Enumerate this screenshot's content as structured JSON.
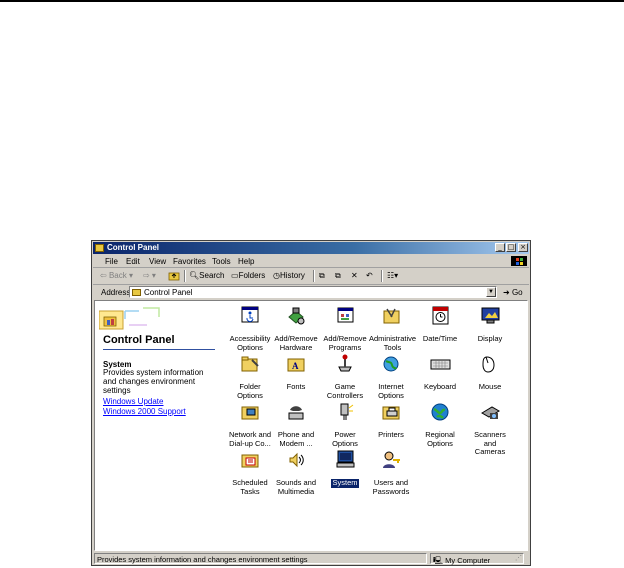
{
  "window": {
    "title": "Control Panel",
    "buttons": {
      "minimize": "_",
      "maximize": "□",
      "close": "×"
    }
  },
  "menu": [
    "File",
    "Edit",
    "View",
    "Favorites",
    "Tools",
    "Help"
  ],
  "toolbar": {
    "back": "Back",
    "search": "Search",
    "folders": "Folders",
    "history": "History"
  },
  "address": {
    "label": "Address",
    "value": "Control Panel",
    "go": "Go"
  },
  "left_pane": {
    "title": "Control Panel",
    "selected_name": "System",
    "selected_description": "Provides system information and changes environment settings",
    "links": [
      "Windows Update",
      "Windows 2000 Support"
    ]
  },
  "icons": [
    {
      "label": "Accessibility Options",
      "icon": "accessibility-icon"
    },
    {
      "label": "Add/Remove Hardware",
      "icon": "add-remove-hardware-icon"
    },
    {
      "label": "Add/Remove Programs",
      "icon": "add-remove-programs-icon"
    },
    {
      "label": "Administrative Tools",
      "icon": "administrative-tools-icon"
    },
    {
      "label": "Date/Time",
      "icon": "date-time-icon"
    },
    {
      "label": "Display",
      "icon": "display-icon"
    },
    {
      "label": "Folder Options",
      "icon": "folder-options-icon"
    },
    {
      "label": "Fonts",
      "icon": "fonts-icon"
    },
    {
      "label": "Game Controllers",
      "icon": "game-controllers-icon"
    },
    {
      "label": "Internet Options",
      "icon": "internet-options-icon"
    },
    {
      "label": "Keyboard",
      "icon": "keyboard-icon"
    },
    {
      "label": "Mouse",
      "icon": "mouse-icon"
    },
    {
      "label": "Network and Dial-up Co...",
      "icon": "network-icon"
    },
    {
      "label": "Phone and Modem ...",
      "icon": "phone-modem-icon"
    },
    {
      "label": "Power Options",
      "icon": "power-options-icon"
    },
    {
      "label": "Printers",
      "icon": "printers-icon"
    },
    {
      "label": "Regional Options",
      "icon": "regional-options-icon"
    },
    {
      "label": "Scanners and Cameras",
      "icon": "scanners-cameras-icon"
    },
    {
      "label": "Scheduled Tasks",
      "icon": "scheduled-tasks-icon"
    },
    {
      "label": "Sounds and Multimedia",
      "icon": "sounds-multimedia-icon"
    },
    {
      "label": "System",
      "icon": "system-icon",
      "selected": true
    },
    {
      "label": "Users and Passwords",
      "icon": "users-passwords-icon"
    }
  ],
  "status": {
    "text": "Provides system information and changes environment settings",
    "zone": "My Computer"
  },
  "colors": {
    "titlebar": "#0a246a",
    "chrome": "#d4d0c8",
    "selection": "#0a246a",
    "link": "#0000ff"
  }
}
